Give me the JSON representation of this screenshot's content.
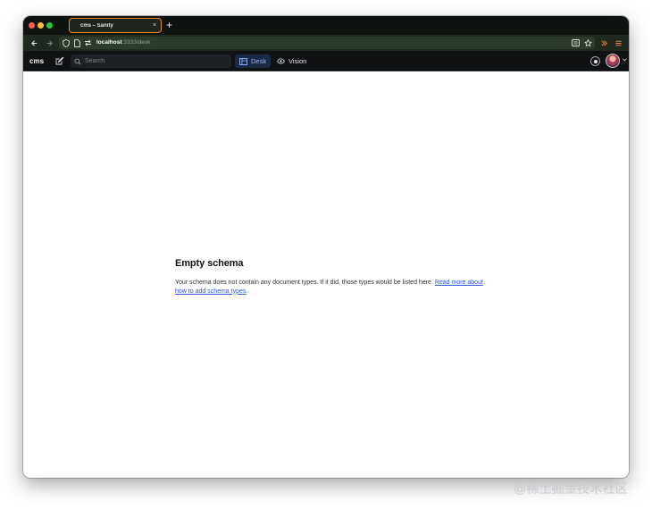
{
  "browser": {
    "tab": {
      "title": "cms – Sanity",
      "close_glyph": "×"
    },
    "new_tab_glyph": "+",
    "url": {
      "host": "localhost",
      "rest": ":3333/desk"
    }
  },
  "app": {
    "brand": "cms",
    "search": {
      "placeholder": "Search"
    },
    "tools": [
      {
        "label": "Desk",
        "icon": "desk-icon",
        "active": true
      },
      {
        "label": "Vision",
        "icon": "eye-icon",
        "active": false
      }
    ]
  },
  "content": {
    "heading": "Empty schema",
    "body_prefix": "Your schema does not contain any document types. If it did, those types would be listed here. ",
    "link_text": "Read more about how to add schema types",
    "body_suffix": "."
  },
  "watermark": "@稀土掘金技术社区",
  "colors": {
    "tab_accent": "#e9852c",
    "nav_bg": "#20291f",
    "app_bg": "#101112",
    "active_tool_bg": "#1c2a45",
    "active_tool_text": "#8db4ff",
    "link": "#2f56d4"
  }
}
